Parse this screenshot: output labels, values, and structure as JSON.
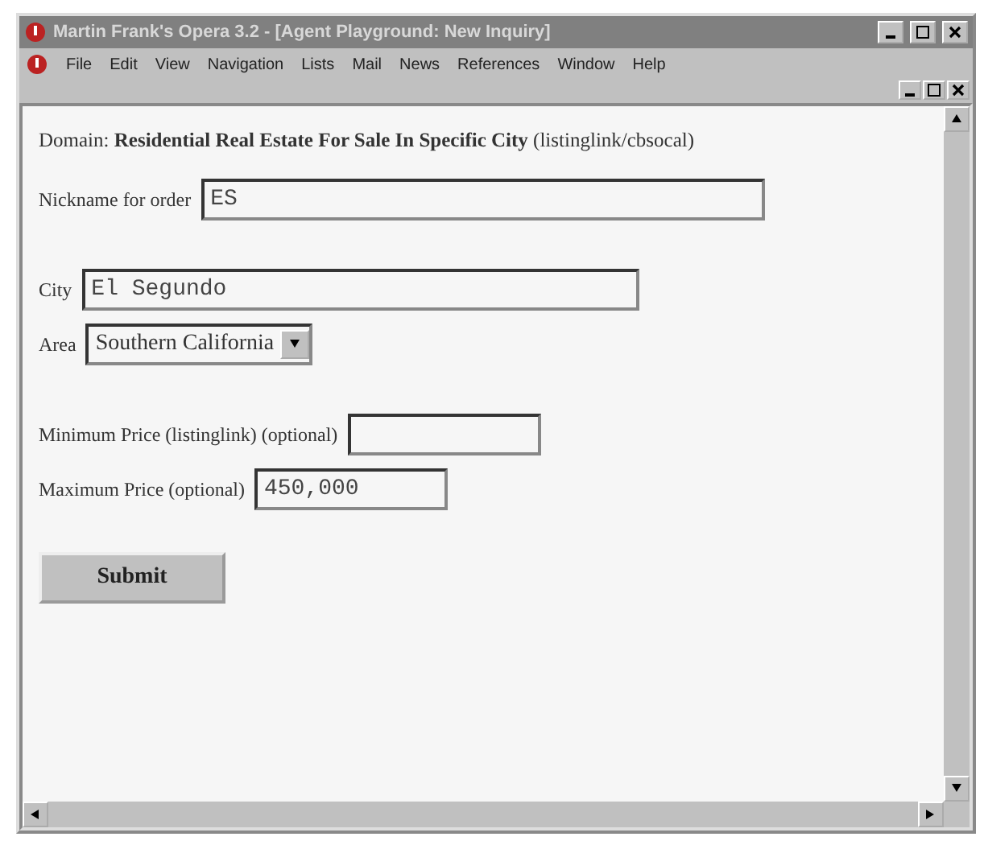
{
  "window": {
    "title": "Martin Frank's Opera 3.2 - [Agent Playground: New Inquiry]"
  },
  "menu": [
    {
      "label": "File"
    },
    {
      "label": "Edit"
    },
    {
      "label": "View"
    },
    {
      "label": "Navigation"
    },
    {
      "label": "Lists"
    },
    {
      "label": "Mail"
    },
    {
      "label": "News"
    },
    {
      "label": "References"
    },
    {
      "label": "Window"
    },
    {
      "label": "Help"
    }
  ],
  "domain": "Domain: **Residential Real Estate For Sale In Specific City** (listinglink/cbsocal)",
  "form": [
    {
      "kind": "text",
      "label": "Nickname for order",
      "value": "ES"
    },
    {
      "kind": "gap"
    },
    {
      "kind": "text",
      "label": "City",
      "value": "El Segundo"
    },
    {
      "kind": "select",
      "label": "Area",
      "value": "Southern California"
    },
    {
      "kind": "gap"
    },
    {
      "kind": "text",
      "label": "Minimum Price (listinglink) (optional)"
    },
    {
      "kind": "text",
      "label": "Maximum Price (optional)",
      "value": "450,000"
    }
  ],
  "submit": "Submit"
}
